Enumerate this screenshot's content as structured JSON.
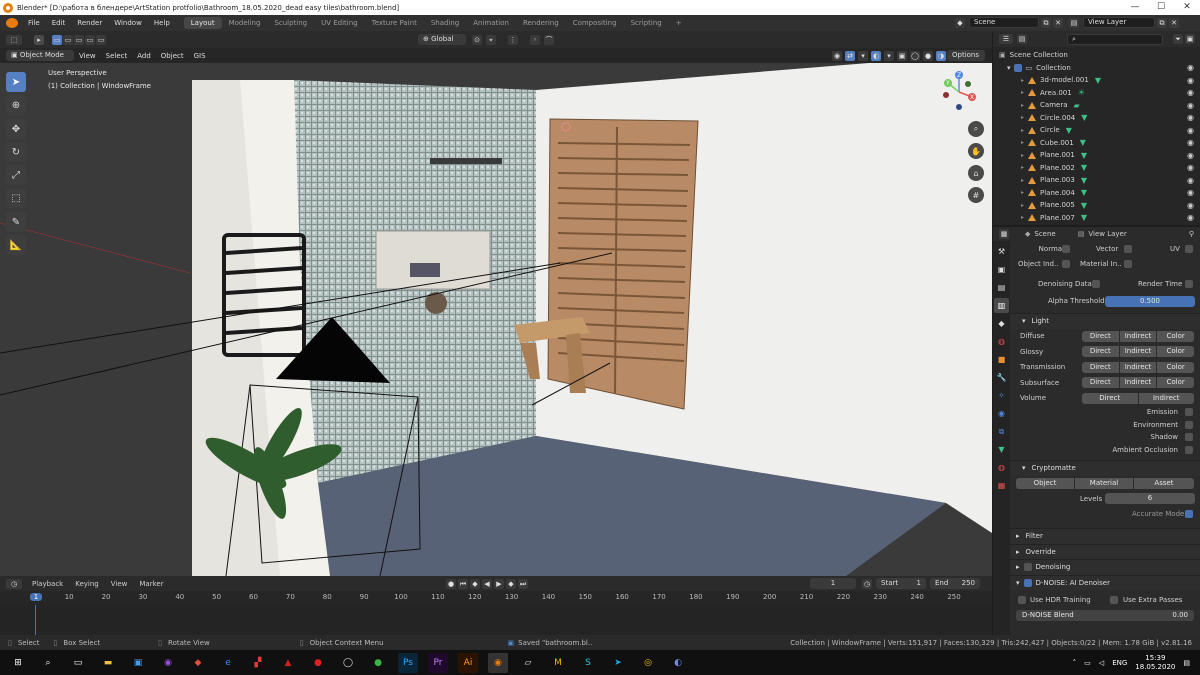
{
  "window": {
    "title": "Blender* [D:\\работа в блендере\\ArtStation protfolio\\Bathroom_18.05.2020_dead easy tiles\\bathroom.blend]",
    "minimize": "—",
    "maximize": "☐",
    "close": "✕"
  },
  "menu": [
    "File",
    "Edit",
    "Render",
    "Window",
    "Help"
  ],
  "workspaces": [
    "Layout",
    "Modeling",
    "Sculpting",
    "UV Editing",
    "Texture Paint",
    "Shading",
    "Animation",
    "Rendering",
    "Compositing",
    "Scripting"
  ],
  "active_workspace": "Layout",
  "add_workspace": "+",
  "scene": {
    "label": "Scene",
    "view_layer": "View Layer"
  },
  "viewport": {
    "mode": "Object Mode",
    "menu": [
      "View",
      "Select",
      "Add",
      "Object",
      "GIS"
    ],
    "transform_orientation": "Global",
    "options": "Options",
    "overlay_line1": "User Perspective",
    "overlay_line2": "(1) Collection | WindowFrame",
    "gizmo": {
      "x": "X",
      "y": "Y",
      "z": "Z"
    }
  },
  "outliner": {
    "search_placeholder": "",
    "root": "Scene Collection",
    "collection": "Collection",
    "items": [
      {
        "name": "3d-model.001",
        "icon": "mesh"
      },
      {
        "name": "Area.001",
        "icon": "light"
      },
      {
        "name": "Camera",
        "icon": "camera"
      },
      {
        "name": "Circle.004",
        "icon": "mesh"
      },
      {
        "name": "Circle",
        "icon": "mesh"
      },
      {
        "name": "Cube.001",
        "icon": "mesh"
      },
      {
        "name": "Plane.001",
        "icon": "mesh"
      },
      {
        "name": "Plane.002",
        "icon": "mesh"
      },
      {
        "name": "Plane.003",
        "icon": "mesh"
      },
      {
        "name": "Plane.004",
        "icon": "mesh"
      },
      {
        "name": "Plane.005",
        "icon": "mesh"
      },
      {
        "name": "Plane.007",
        "icon": "mesh"
      }
    ]
  },
  "properties": {
    "breadcrumb_scene": "Scene",
    "breadcrumb_layer": "View Layer",
    "passes_row1": [
      "Normal",
      "Vector",
      "UV"
    ],
    "passes_row2": [
      "Object Ind..",
      "Material In.."
    ],
    "denoising_data": "Denoising Data",
    "render_time": "Render Time",
    "alpha_threshold_label": "Alpha Threshold",
    "alpha_threshold_value": "0.500",
    "light_section": "Light",
    "light_rows": [
      {
        "label": "Diffuse",
        "buttons": [
          "Direct",
          "Indirect",
          "Color"
        ]
      },
      {
        "label": "Glossy",
        "buttons": [
          "Direct",
          "Indirect",
          "Color"
        ]
      },
      {
        "label": "Transmission",
        "buttons": [
          "Direct",
          "Indirect",
          "Color"
        ]
      },
      {
        "label": "Subsurface",
        "buttons": [
          "Direct",
          "Indirect",
          "Color"
        ]
      },
      {
        "label": "Volume",
        "buttons": [
          "Direct",
          "Indirect"
        ]
      }
    ],
    "light_checks": [
      "Emission",
      "Environment",
      "Shadow",
      "Ambient Occlusion"
    ],
    "cryptomatte_section": "Cryptomatte",
    "crypto_buttons": [
      "Object",
      "Material",
      "Asset"
    ],
    "levels_label": "Levels",
    "levels_value": "6",
    "accurate_mode": "Accurate Mode",
    "filter": "Filter",
    "override": "Override",
    "denoising": "Denoising",
    "dnoise": "D-NOISE: AI Denoiser",
    "use_hdr": "Use HDR Training",
    "use_extra": "Use Extra Passes",
    "dnoise_blend_label": "D-NOISE Blend",
    "dnoise_blend_value": "0.00"
  },
  "timeline": {
    "menu": [
      "Playback",
      "Keying",
      "View",
      "Marker"
    ],
    "current_frame": "1",
    "start_label": "Start",
    "start_value": "1",
    "end_label": "End",
    "end_value": "250",
    "ticks": [
      "1",
      "10",
      "20",
      "30",
      "40",
      "50",
      "60",
      "70",
      "80",
      "90",
      "100",
      "110",
      "120",
      "130",
      "140",
      "150",
      "160",
      "170",
      "180",
      "190",
      "200",
      "210",
      "220",
      "230",
      "240",
      "250"
    ]
  },
  "statusbar": {
    "select": "Select",
    "box_select": "Box Select",
    "rotate_view": "Rotate View",
    "context_menu": "Object Context Menu",
    "saved": "Saved \"bathroom.bl..",
    "stats": "Collection | WindowFrame | Verts:151,917 | Faces:130,329 | Tris:242,427 | Objects:0/22 | Mem: 1.78 GiB | v2.81.16"
  },
  "taskbar": {
    "lang": "ENG",
    "time": "15:39",
    "date": "18.05.2020"
  },
  "colors": {
    "accent": "#4772b3",
    "active_tool": "#5680c2",
    "orange": "#e39b3d",
    "mesh_green": "#3fbf86"
  }
}
